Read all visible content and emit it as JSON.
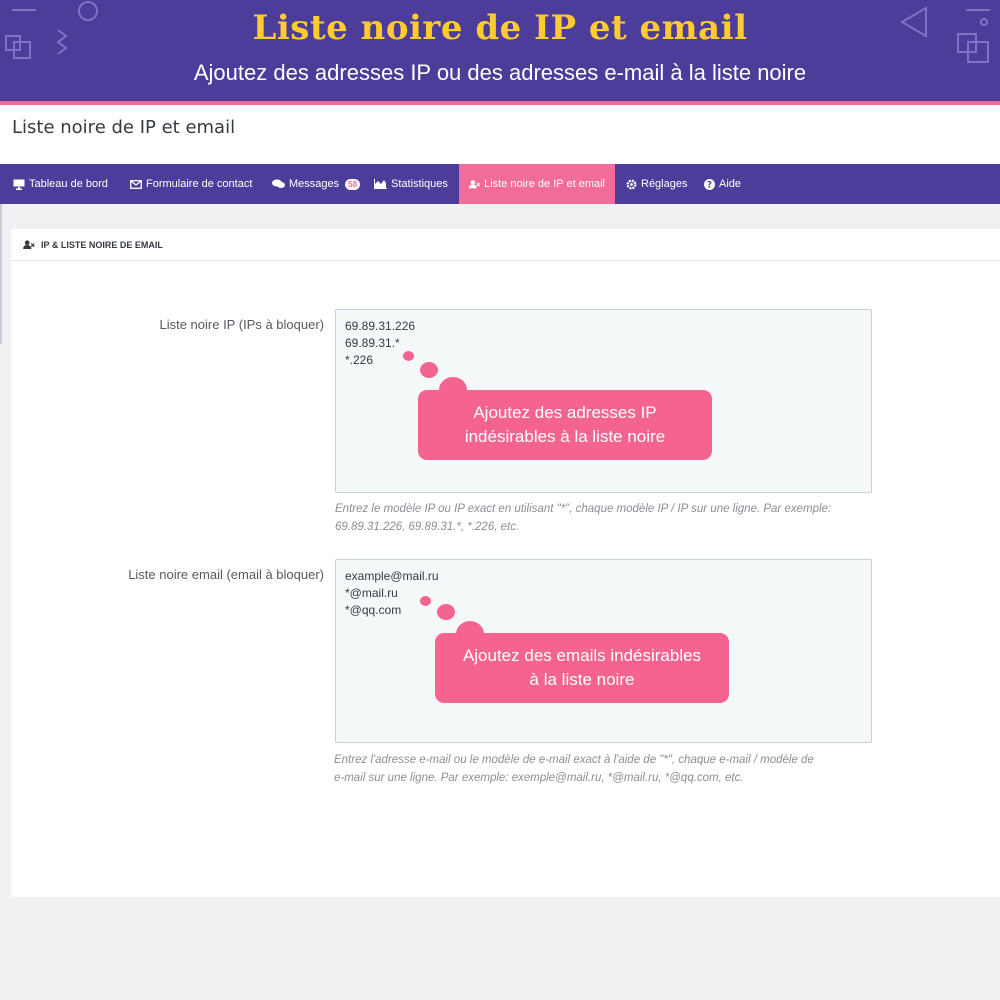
{
  "banner": {
    "title": "Liste noire de IP et email",
    "subtitle": "Ajoutez des adresses IP ou des adresses e-mail à la liste noire"
  },
  "page": {
    "title": "Liste noire de IP et email"
  },
  "nav": {
    "items": [
      {
        "label": "Tableau de bord",
        "icon": "monitor-icon"
      },
      {
        "label": "Formulaire de contact",
        "icon": "envelope-icon"
      },
      {
        "label": "Messages",
        "icon": "comments-icon",
        "badge": "58"
      },
      {
        "label": "Statistiques",
        "icon": "area-chart-icon"
      },
      {
        "label": "Liste noire de IP et email",
        "icon": "user-times-icon",
        "active": true
      },
      {
        "label": "Réglages",
        "icon": "gear-icon"
      },
      {
        "label": "Aide",
        "icon": "question-circle-icon"
      }
    ]
  },
  "panel": {
    "header": "IP & LISTE NOIRE DE EMAIL",
    "ip": {
      "label": "Liste noire IP (IPs à bloquer)",
      "lines": [
        "69.89.31.226",
        "69.89.31.*",
        "*.226"
      ],
      "callout": [
        "Ajoutez des adresses IP",
        "indésirables à la liste noire"
      ],
      "help": [
        "Entrez le modèle IP ou IP exact en utilisant \"*\", chaque modèle IP / IP sur une ligne. Par exemple:",
        "69.89.31.226, 69.89.31.*, *.226, etc."
      ]
    },
    "email": {
      "label": "Liste noire email (email à bloquer)",
      "lines": [
        "example@mail.ru",
        "*@mail.ru",
        "*@qq.com"
      ],
      "callout": [
        "Ajoutez des emails indésirables",
        "à la liste noire"
      ],
      "help": [
        "Entrez l'adresse e-mail ou le modèle de e-mail exact à l'aide de \"*\", chaque e-mail / modèle de",
        "e-mail sur une ligne. Par exemple: exemple@mail.ru, *@mail.ru, *@qq.com, etc."
      ]
    }
  },
  "colors": {
    "purple": "#4c3d9a",
    "pink": "#f16c98",
    "gold": "#ffcb2f"
  }
}
